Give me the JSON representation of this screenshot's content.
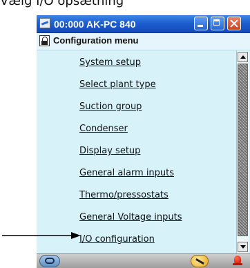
{
  "caption": "Vælg I/O opsætning",
  "window": {
    "title": "00:000 AK-PC 840"
  },
  "menu": {
    "title": "Configuration menu",
    "items": [
      {
        "label": "System setup"
      },
      {
        "label": "Select plant type"
      },
      {
        "label": "Suction group"
      },
      {
        "label": "Condenser"
      },
      {
        "label": "Display setup"
      },
      {
        "label": "General alarm inputs"
      },
      {
        "label": "Thermo/pressostats"
      },
      {
        "label": "General Voltage inputs"
      },
      {
        "label": "I/O configuration"
      }
    ]
  },
  "icons": {
    "app": "monitor-icon",
    "lock": "lock-icon",
    "status_left": "user-icon",
    "status_wrench": "wrench-icon",
    "status_alarm": "alarm-bell-icon",
    "arrow": "arrow-right-icon"
  },
  "colors": {
    "titlebar": "#1d5fd0",
    "background": "#d8f2fa",
    "close_button": "#c8441f",
    "alarm": "#d31600"
  }
}
